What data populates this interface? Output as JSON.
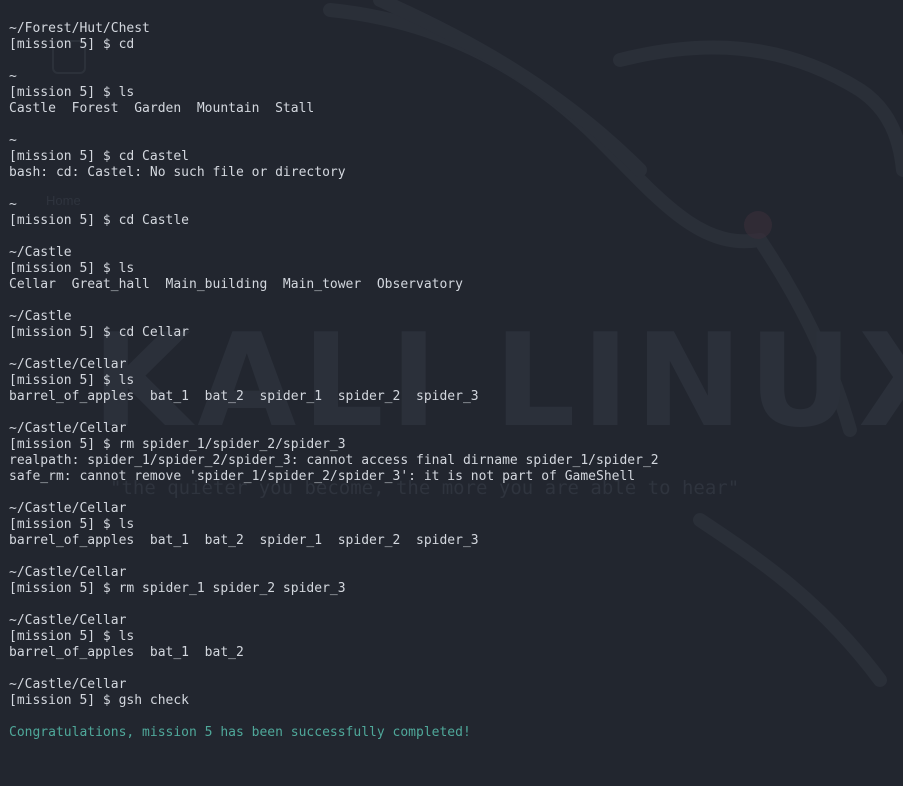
{
  "wallpaper": {
    "logo_text": "KALI LINUX",
    "tagline": "\"the quieter you become, the more you are able to hear\"",
    "desktop_home_label": "Home"
  },
  "terminal": {
    "lines": [
      "~/Forest/Hut/Chest",
      "[mission 5] $ cd",
      "",
      "~",
      "[mission 5] $ ls",
      "Castle  Forest  Garden  Mountain  Stall",
      "",
      "~",
      "[mission 5] $ cd Castel",
      "bash: cd: Castel: No such file or directory",
      "",
      "~",
      "[mission 5] $ cd Castle",
      "",
      "~/Castle",
      "[mission 5] $ ls",
      "Cellar  Great_hall  Main_building  Main_tower  Observatory",
      "",
      "~/Castle",
      "[mission 5] $ cd Cellar",
      "",
      "~/Castle/Cellar",
      "[mission 5] $ ls",
      "barrel_of_apples  bat_1  bat_2  spider_1  spider_2  spider_3",
      "",
      "~/Castle/Cellar",
      "[mission 5] $ rm spider_1/spider_2/spider_3",
      "realpath: spider_1/spider_2/spider_3: cannot access final dirname spider_1/spider_2",
      "safe_rm: cannot remove 'spider_1/spider_2/spider_3': it is not part of GameShell",
      "",
      "~/Castle/Cellar",
      "[mission 5] $ ls",
      "barrel_of_apples  bat_1  bat_2  spider_1  spider_2  spider_3",
      "",
      "~/Castle/Cellar",
      "[mission 5] $ rm spider_1 spider_2 spider_3",
      "",
      "~/Castle/Cellar",
      "[mission 5] $ ls",
      "barrel_of_apples  bat_1  bat_2",
      "",
      "~/Castle/Cellar",
      "[mission 5] $ gsh check",
      "",
      "Congratulations, mission 5 has been successfully completed!"
    ],
    "success_color": "#4fa89a",
    "text_color": "#d3d7de",
    "background_color": "#22262f"
  }
}
